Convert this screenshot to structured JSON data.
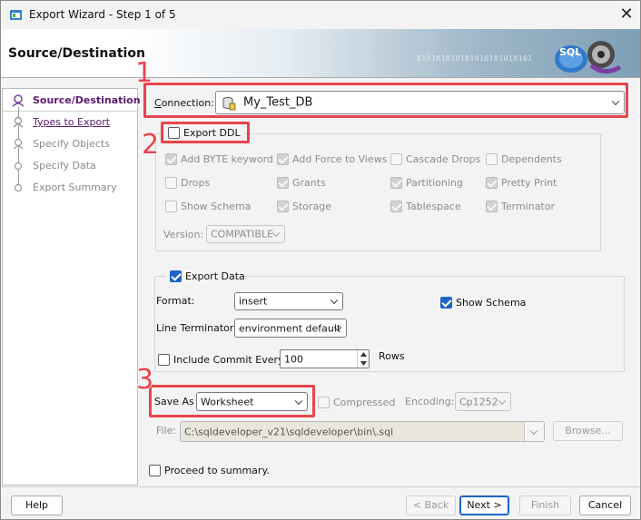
{
  "window": {
    "title": "Export Wizard - Step 1 of 5",
    "close_glyph": "✕"
  },
  "banner": {
    "title": "Source/Destination",
    "binary_text": "010101010101010101010101"
  },
  "steps": [
    {
      "label": "Source/Destination",
      "state": "active"
    },
    {
      "label": "Types to Export",
      "state": "link"
    },
    {
      "label": "Specify Objects",
      "state": "disabled"
    },
    {
      "label": "Specify Data",
      "state": "disabled"
    },
    {
      "label": "Export Summary",
      "state": "disabled"
    }
  ],
  "connection": {
    "label": "Connection:",
    "value": "My_Test_DB"
  },
  "ddl": {
    "label": "Export DDL",
    "checked": false,
    "options": [
      {
        "label": "Add BYTE keyword",
        "checked": true
      },
      {
        "label": "Add Force to Views",
        "checked": true
      },
      {
        "label": "Cascade Drops",
        "checked": false
      },
      {
        "label": "Dependents",
        "checked": false
      },
      {
        "label": "Drops",
        "checked": false
      },
      {
        "label": "Grants",
        "checked": true
      },
      {
        "label": "Partitioning",
        "checked": true
      },
      {
        "label": "Pretty Print",
        "checked": true
      },
      {
        "label": "Show Schema",
        "checked": false
      },
      {
        "label": "Storage",
        "checked": true
      },
      {
        "label": "Tablespace",
        "checked": true
      },
      {
        "label": "Terminator",
        "checked": true
      }
    ],
    "version_label": "Version:",
    "version_value": "COMPATIBLE"
  },
  "data_export": {
    "label": "Export Data",
    "checked": true,
    "format_label": "Format:",
    "format_value": "insert",
    "show_schema_label": "Show Schema",
    "show_schema_checked": true,
    "line_terminator_label": "Line Terminator:",
    "line_terminator_value": "environment default",
    "include_commit_label": "Include Commit Every",
    "include_commit_checked": false,
    "commit_value": "100",
    "rows_label": "Rows"
  },
  "save": {
    "save_as_label": "Save As",
    "save_as_value": "Worksheet",
    "compressed_label": "Compressed",
    "encoding_label": "Encoding:",
    "encoding_value": "Cp1252",
    "file_label": "File:",
    "file_value": "C:\\sqldeveloper_v21\\sqldeveloper\\bin\\.sql",
    "browse_label": "Browse..."
  },
  "proceed": {
    "label": "Proceed to summary.",
    "checked": false
  },
  "buttons": {
    "help": "Help",
    "back": "< Back",
    "next": "Next >",
    "finish": "Finish",
    "cancel": "Cancel"
  },
  "annotations": [
    "1",
    "2",
    "3"
  ],
  "colors": {
    "annotation": "#e8444d",
    "accent": "#1c64c8",
    "step_active": "#5b1a6f"
  }
}
